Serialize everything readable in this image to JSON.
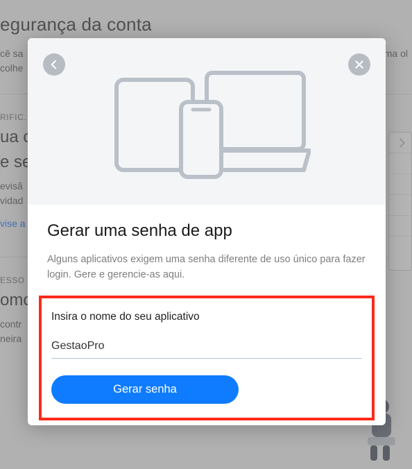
{
  "background": {
    "page_title": "egurança da conta",
    "sub_line1": "cê sa",
    "sub_line2": "colhe",
    "sub_line3": "ma ol",
    "section1": {
      "label": "RIFIC.",
      "h2a": "ua c",
      "h2b": "e se",
      "p1": "evisã",
      "p2": "vidad",
      "link": "vise a"
    },
    "section2": {
      "label": "ESSO",
      "h2": "omc",
      "p1": "contr",
      "p2": "neira"
    }
  },
  "modal": {
    "title": "Gerar uma senha de app",
    "description": "Alguns aplicativos exigem uma senha diferente de uso único para fazer login. Gere e gerencie-as aqui.",
    "field_label": "Insira o nome do seu aplicativo",
    "app_name_value": "GestaoPro",
    "generate_label": "Gerar senha"
  },
  "icons": {
    "back": "back-icon",
    "close": "close-icon",
    "devices": "devices-illustration"
  },
  "colors": {
    "primary": "#0f7cff",
    "highlight_border": "#ff2a1a",
    "hero_bg": "#f3f5f7"
  }
}
